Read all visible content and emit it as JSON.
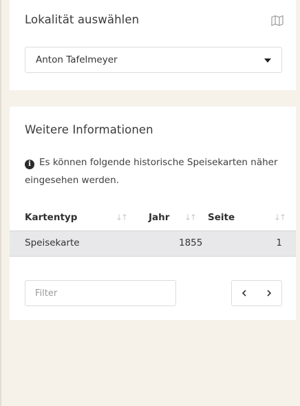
{
  "locality": {
    "title": "Lokalität auswählen",
    "map_icon": "map-icon",
    "select": {
      "value": "Anton Tafelmeyer",
      "icon": "caret-down-icon"
    }
  },
  "info": {
    "title": "Weitere Informationen",
    "info_icon": "info-circle-icon",
    "message": "Es können folgende historische Speisekarten näher eingesehen werden.",
    "table": {
      "columns": [
        "Kartentyp",
        "Jahr",
        "Seite"
      ],
      "sort_icon": "sort-icon",
      "rows": [
        {
          "kartentyp": "Speisekarte",
          "jahr": "1855",
          "seite": "1"
        }
      ]
    },
    "filter": {
      "placeholder": "Filter",
      "value": ""
    },
    "pager": {
      "prev_icon": "chevron-left-icon",
      "next_icon": "chevron-right-icon"
    }
  },
  "colors": {
    "page_background": "#f6f2ea",
    "card_background": "#ffffff",
    "selected_row": "#e8e8ea"
  }
}
